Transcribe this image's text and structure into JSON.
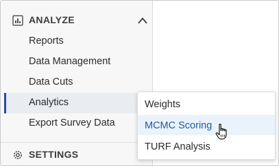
{
  "sidebar": {
    "section": {
      "title": "ANALYZE",
      "icon": "bar-chart-icon"
    },
    "items": [
      {
        "label": "Reports"
      },
      {
        "label": "Data Management"
      },
      {
        "label": "Data Cuts"
      },
      {
        "label": "Analytics",
        "active": true
      },
      {
        "label": "Export Survey Data"
      }
    ],
    "settings": {
      "title": "SETTINGS",
      "icon": "gear-icon"
    }
  },
  "submenu": {
    "items": [
      {
        "label": "Weights"
      },
      {
        "label": "MCMC Scoring",
        "hovered": true
      },
      {
        "label": "TURF Analysis"
      }
    ]
  },
  "colors": {
    "accent": "#1f4fa3",
    "hover_bg": "#eaf3fb",
    "hover_text": "#1d5aa6",
    "sidebar_bg": "#f7f7f7"
  }
}
